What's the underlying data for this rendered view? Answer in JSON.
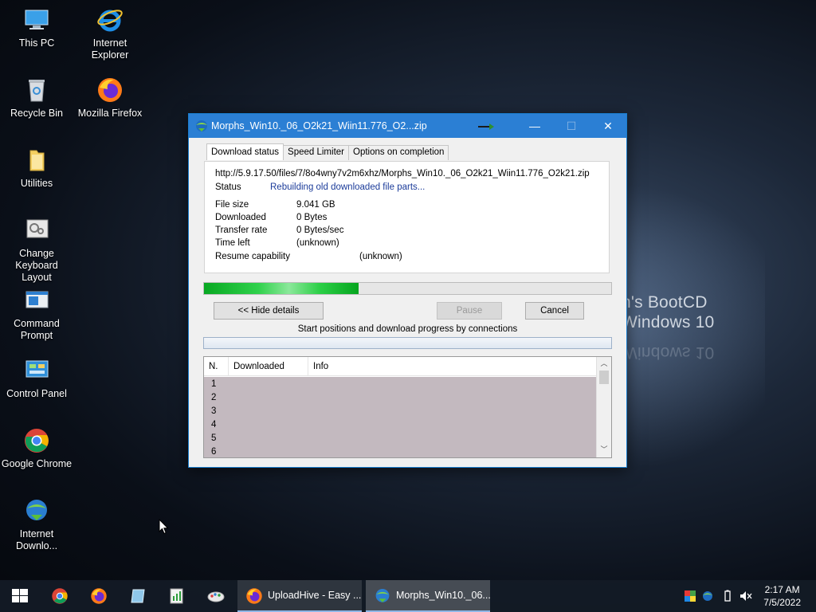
{
  "desktop": {
    "icons": [
      {
        "label": "This PC",
        "icon": "this-pc-icon"
      },
      {
        "label": "Internet Explorer",
        "icon": "internet-explorer-icon"
      },
      {
        "label": "Recycle Bin",
        "icon": "recycle-bin-icon"
      },
      {
        "label": "Mozilla Firefox",
        "icon": "firefox-icon"
      },
      {
        "label": "Utilities",
        "icon": "folder-icon"
      },
      {
        "label": "Change Keyboard Layout",
        "icon": "keyboard-layout-icon"
      },
      {
        "label": "Command Prompt",
        "icon": "command-prompt-icon"
      },
      {
        "label": "Control Panel",
        "icon": "control-panel-icon"
      },
      {
        "label": "Google Chrome",
        "icon": "chrome-icon"
      },
      {
        "label": "Internet Downlo...",
        "icon": "idm-icon"
      }
    ],
    "wallpaper_text": {
      "line1": "n's BootCD",
      "line2": "Windows 10"
    }
  },
  "window": {
    "title": "Morphs_Win10._06_O2k21_Wiin11.776_O2...zip",
    "controls": {
      "minimize": "—",
      "maximize": "☐",
      "close": "✕"
    },
    "tabs": [
      {
        "label": "Download status",
        "active": true
      },
      {
        "label": "Speed Limiter",
        "active": false
      },
      {
        "label": "Options on completion",
        "active": false
      }
    ],
    "url": "http://5.9.17.50/files/7/8o4wny7v2m6xhz/Morphs_Win10._06_O2k21_Wiin11.776_O2k21.zip",
    "status_label": "Status",
    "status_value": "Rebuilding old downloaded file parts...",
    "fields": {
      "file_size_label": "File size",
      "file_size_value": "9.041  GB",
      "downloaded_label": "Downloaded",
      "downloaded_value": "0 Bytes",
      "transfer_rate_label": "Transfer rate",
      "transfer_rate_value": "0  Bytes/sec",
      "time_left_label": "Time left",
      "time_left_value": "(unknown)",
      "resume_label": "Resume capability",
      "resume_value": "(unknown)"
    },
    "progress_fraction": 0.38,
    "buttons": {
      "hide_details": "<< Hide details",
      "pause": "Pause",
      "cancel": "Cancel"
    },
    "connections_caption": "Start positions and download progress by connections",
    "list": {
      "columns": [
        "N.",
        "Downloaded",
        "Info"
      ],
      "rows": [
        "1",
        "2",
        "3",
        "4",
        "5",
        "6"
      ]
    }
  },
  "taskbar": {
    "pinned": [
      "start-icon",
      "chrome-icon",
      "firefox-icon",
      "tablet-icon",
      "notepad-chart-icon",
      "paint-icon"
    ],
    "tasks": [
      {
        "label": "UploadHive - Easy ...",
        "icon": "firefox-icon",
        "active": false
      },
      {
        "label": "Morphs_Win10._06...",
        "icon": "idm-icon",
        "active": true
      }
    ],
    "tray": [
      "color-icon",
      "idm-tray-icon",
      "usb-icon",
      "volume-muted-icon"
    ],
    "time": "2:17 AM",
    "date": "7/5/2022"
  },
  "colors": {
    "title_bar": "#2b7fd4",
    "progress": "#1fc43a",
    "status_text": "#1c3c9a",
    "list_bg": "#c3b9bf"
  }
}
